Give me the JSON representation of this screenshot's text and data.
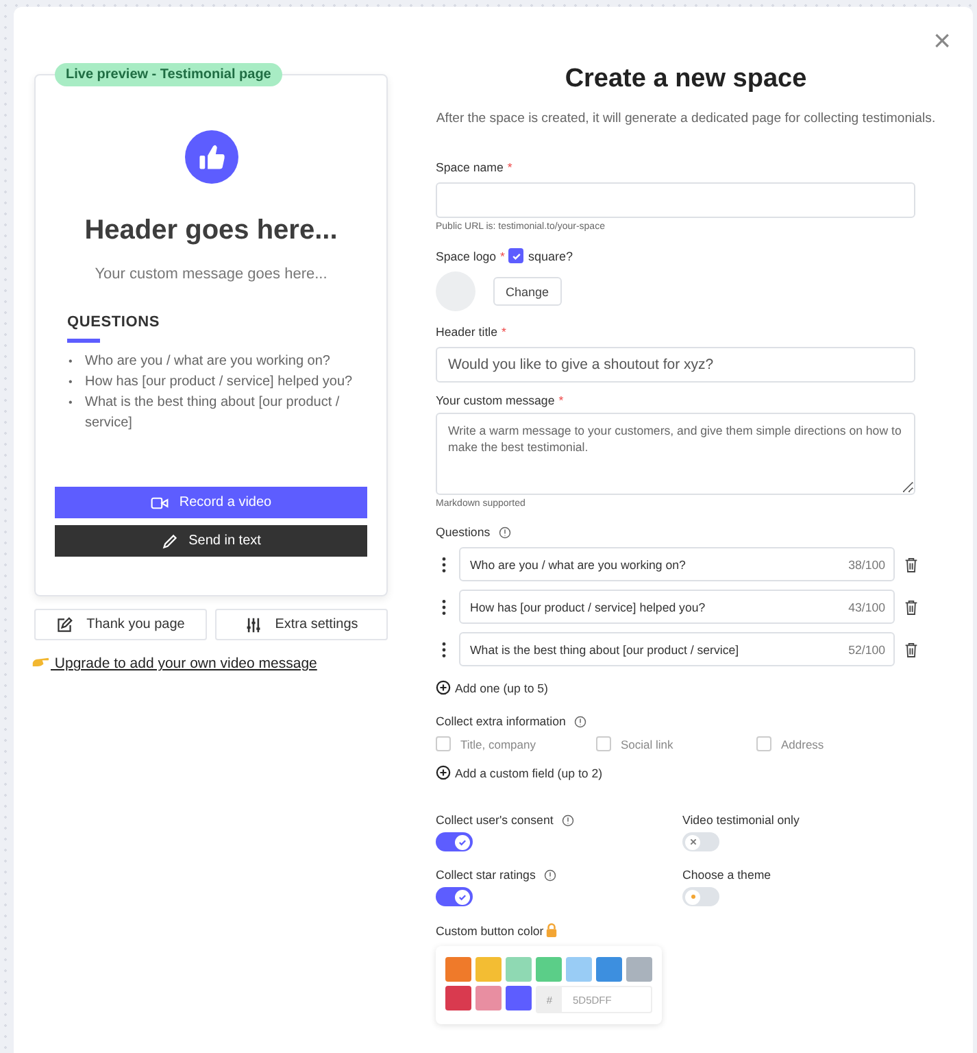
{
  "preview": {
    "badge": "Live preview - Testimonial page",
    "header": "Header goes here...",
    "message": "Your custom message goes here...",
    "questions_title": "QUESTIONS",
    "bullet": "•",
    "questions": [
      "Who are you / what are you working on?",
      "How has [our product / service] helped you?",
      "What is the best thing about [our product / service]"
    ],
    "record_button": "Record a video",
    "text_button": "Send in text"
  },
  "side_buttons": [
    {
      "kind": "thanks",
      "label": "Thank you page"
    },
    {
      "kind": "settings",
      "label": "Extra settings"
    }
  ],
  "upgrade_link": "Upgrade to add your own video message",
  "close": "×",
  "form": {
    "title": "Create a new space",
    "subtitle": "After the space is created, it will generate a dedicated page for collecting testimonials.",
    "space_name": {
      "label": "Space name",
      "required": "*",
      "hint": "Public URL is: testimonial.to/your-space"
    },
    "logo": {
      "label": "Space logo",
      "required": "*",
      "square_label": "square?",
      "square_checked": true,
      "change_button": "Change"
    },
    "header_title": {
      "label": "Header title",
      "required": "*",
      "placeholder": "Would you like to give a shoutout for xyz?"
    },
    "custom_message": {
      "label": "Your custom message",
      "required": "*",
      "placeholder": "Write a warm message to your customers, and give them simple directions on how to make the best testimonial.",
      "hint": "Markdown supported"
    },
    "questions_label": "Questions",
    "questions": [
      {
        "value": "Who are you / what are you working on?",
        "count": "38/100"
      },
      {
        "value": "How has [our product / service] helped you?",
        "count": "43/100"
      },
      {
        "value": "What is the best thing about [our product / service]",
        "count": "52/100"
      }
    ],
    "add_question": "Add one (up to 5)",
    "extra_label": "Collect extra information",
    "extra_options": [
      {
        "label": "Title, company",
        "checked": false
      },
      {
        "label": "Social link",
        "checked": false
      },
      {
        "label": "Address",
        "checked": false
      }
    ],
    "add_field": "Add a custom field (up to 2)",
    "toggles": [
      {
        "label": "Collect user's consent",
        "info": true,
        "on": true,
        "kind": "check"
      },
      {
        "label": "Video testimonial only",
        "info": false,
        "on": false,
        "kind": "cross"
      },
      {
        "label": "Collect star ratings",
        "info": true,
        "on": true,
        "kind": "check"
      },
      {
        "label": "Choose a theme",
        "info": false,
        "on": false,
        "kind": "sun"
      }
    ],
    "color_label": "Custom button color",
    "swatches": [
      {
        "color": "#ef7a2a"
      },
      {
        "color": "#f3bd33"
      },
      {
        "color": "#8fd9b3"
      },
      {
        "color": "#5bce88"
      },
      {
        "color": "#99ccf5"
      },
      {
        "color": "#3d8fdf"
      },
      {
        "color": "#a9b2bc"
      },
      {
        "color": "#d93a4f"
      },
      {
        "color": "#e88ea1"
      },
      {
        "color": "#5d5dff"
      }
    ],
    "hex_prefix": "#",
    "hex_value": "5D5DFF"
  }
}
